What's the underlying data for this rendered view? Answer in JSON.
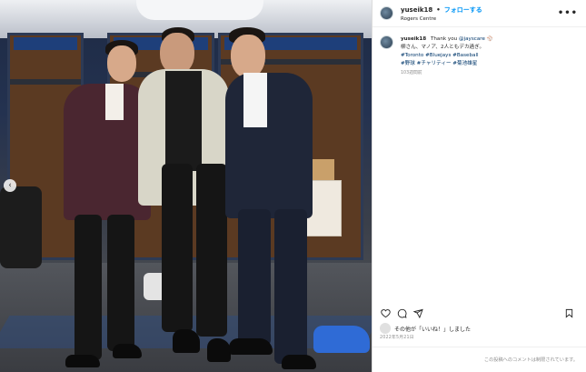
{
  "post": {
    "username": "yuseik18",
    "separator": "•",
    "follow_label": "フォローする",
    "location": "Rogers Centre",
    "more_icon": "more-horizontal-icon",
    "caption": {
      "username": "yuseik18",
      "text_prefix": "Thank you ",
      "mention": "@jayscare",
      "emoji": "⚾",
      "line2": "柳さん、マノア、2人ともデカ過ぎ。",
      "tags_line1": "#Toronto #Bluejays #Baseball",
      "tags_line2": "#野球 #チャリティー #菊池雄星",
      "time_ago": "103週間前"
    },
    "actions": {
      "like_icon": "heart-icon",
      "comment_icon": "comment-icon",
      "share_icon": "send-icon",
      "save_icon": "bookmark-icon"
    },
    "likes_text": "その他が「いいね！」しました",
    "date": "2022年5月21日",
    "comments_disabled": "この投稿へのコメントは制限されています。"
  },
  "photo": {
    "nav_icon": "chevron-left-icon",
    "nav_glyph": "‹"
  },
  "colors": {
    "accent": "#0095f6",
    "link": "#00376b",
    "muted": "#8e8e8e"
  }
}
